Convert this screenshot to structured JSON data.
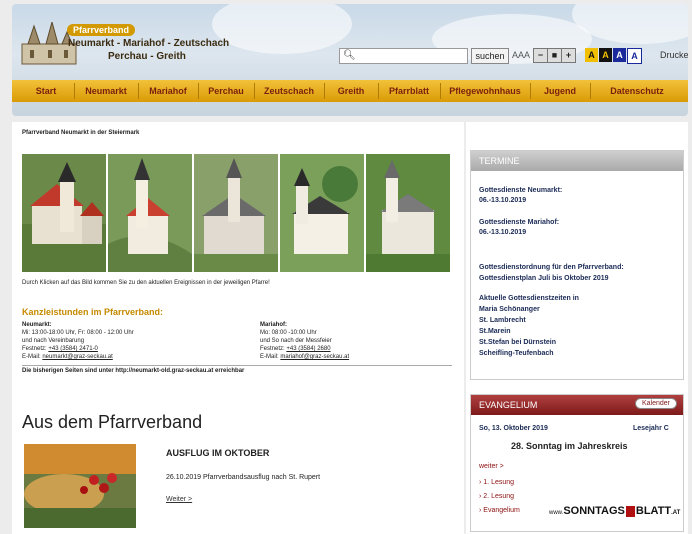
{
  "header": {
    "badge": "Pfarrverband",
    "line1": "Neumarkt - Mariahof - Zeutschach",
    "line2": "Perchau - Greith",
    "search_placeholder": "",
    "search_button": "suchen",
    "font_size_label": "AAA",
    "zoom_minus": "−",
    "zoom_reset": "■",
    "zoom_plus": "+",
    "contrast": [
      "A",
      "A",
      "A",
      "A"
    ],
    "print": "Drucken"
  },
  "nav": [
    "Start",
    "Neumarkt",
    "Mariahof",
    "Perchau",
    "Zeutschach",
    "Greith",
    "Pfarrblatt",
    "Pflegewohnhaus",
    "Jugend",
    "Datenschutz"
  ],
  "main": {
    "intro": "Pfarrverband Neumarkt in der Steiermark",
    "photo_caption": "Durch Klicken auf das Bild kommen Sie zu den aktuellen Ereignissen in der jeweiligen Pfarre!",
    "kanzlei_title": "Kanzleistunden im Pfarrverband:",
    "neumarkt": {
      "name": "Neumarkt:",
      "hours": "Mi: 13:00-18:00 Uhr, Fr: 08:00 - 12:00 Uhr",
      "extra": "und nach Vereinbarung",
      "phone_label": "Festnetz:",
      "phone": "+43 (3584) 2471-0",
      "email_label": "E-Mail:",
      "email": "neumarkt@graz-seckau.at"
    },
    "mariahof": {
      "name": "Mariahof:",
      "hours": "Mo: 08:00 -10:00 Uhr",
      "extra": "und So nach der Messfeier",
      "phone_label": "Festnetz:",
      "phone": "+43 (3584) 2680",
      "email_label": "E-Mail:",
      "email": "mariahof@graz-seckau.at"
    },
    "old_pages": "Die bisherigen Seiten sind unter http://neumarkt-old.graz-seckau.at erreichbar",
    "section_title": "Aus dem Pfarrverband",
    "article": {
      "title": "AUSFLUG IM OKTOBER",
      "text": "26.10.2019 Pfarrverbandsausflug nach St. Rupert",
      "more": "Weiter >"
    }
  },
  "termine": {
    "title": "TERMINE",
    "items": [
      {
        "label": "Gottesdienste Neumarkt:",
        "date": "06.-13.10.2019"
      },
      {
        "label": "Gottesdienste Mariahof:",
        "date": "06.-13.10.2019"
      }
    ],
    "plan_title": "Gottesdienstordnung für den Pfarrverband:",
    "plan_sub": "Gottesdienstplan Juli bis Oktober 2019",
    "current_title": "Aktuelle Gottesdienstzeiten in",
    "places": [
      "Maria Schönanger",
      "St. Lambrecht",
      "St.Marein",
      "St.Stefan bei Dürnstein",
      "Scheifling-Teufenbach"
    ]
  },
  "evangelium": {
    "title": "EVANGELIUM",
    "kalender": "Kalender",
    "date": "So, 13. Oktober 2019",
    "year": "Lesejahr C",
    "sunday": "28. Sonntag im Jahreskreis",
    "more": "weiter >",
    "links": [
      "1. Lesung",
      "2. Lesung",
      "Evangelium"
    ],
    "logo_prefix": "www.",
    "logo_a": "SONNTAGS",
    "logo_b": "BLATT",
    "logo_suffix": ".AT"
  }
}
